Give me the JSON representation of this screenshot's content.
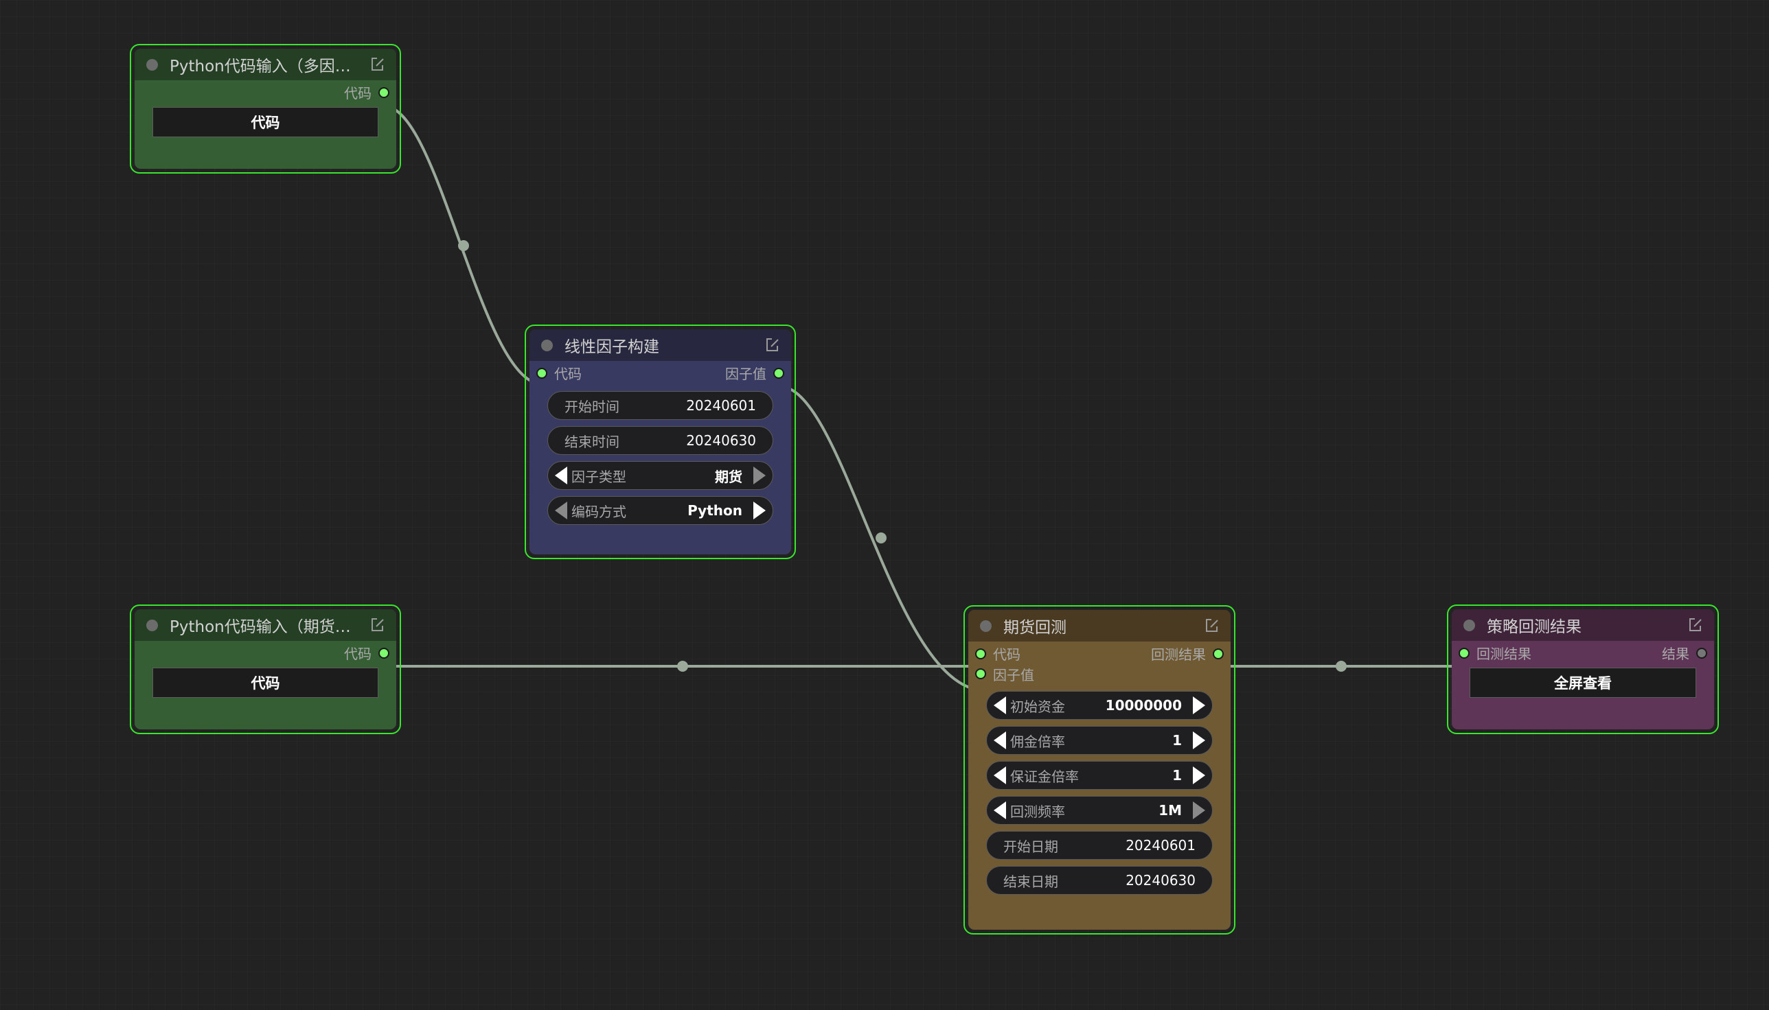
{
  "colors": {
    "background": "#222222",
    "selection_border": "#39e62d",
    "link": "#9aa99a",
    "port_active": "#7cfc6e"
  },
  "nodes": {
    "python_input_1": {
      "title": "Python代码输入（多因子...",
      "output_label": "代码",
      "button_label": "代码",
      "edit_icon": "edit-icon"
    },
    "linear_factor": {
      "title": "线性因子构建",
      "input_label": "代码",
      "output_label": "因子值",
      "start_time": {
        "label": "开始时间",
        "value": "20240601"
      },
      "end_time": {
        "label": "结束时间",
        "value": "20240630"
      },
      "factor_type": {
        "label": "因子类型",
        "value": "期货"
      },
      "encoding": {
        "label": "编码方式",
        "value": "Python"
      },
      "edit_icon": "edit-icon"
    },
    "python_input_2": {
      "title": "Python代码输入（期货回测）",
      "output_label": "代码",
      "button_label": "代码",
      "edit_icon": "edit-icon"
    },
    "futures_backtest": {
      "title": "期货回测",
      "input_code_label": "代码",
      "input_factor_label": "因子值",
      "output_label": "回测结果",
      "initial_capital": {
        "label": "初始资金",
        "value": "10000000"
      },
      "commission_rate": {
        "label": "佣金倍率",
        "value": "1"
      },
      "margin_rate": {
        "label": "保证金倍率",
        "value": "1"
      },
      "frequency": {
        "label": "回测频率",
        "value": "1M"
      },
      "start_date": {
        "label": "开始日期",
        "value": "20240601"
      },
      "end_date": {
        "label": "结束日期",
        "value": "20240630"
      },
      "edit_icon": "edit-icon"
    },
    "strategy_result": {
      "title": "策略回测结果",
      "input_label": "回测结果",
      "output_label": "结果",
      "button_label": "全屏查看",
      "edit_icon": "edit-icon"
    }
  }
}
